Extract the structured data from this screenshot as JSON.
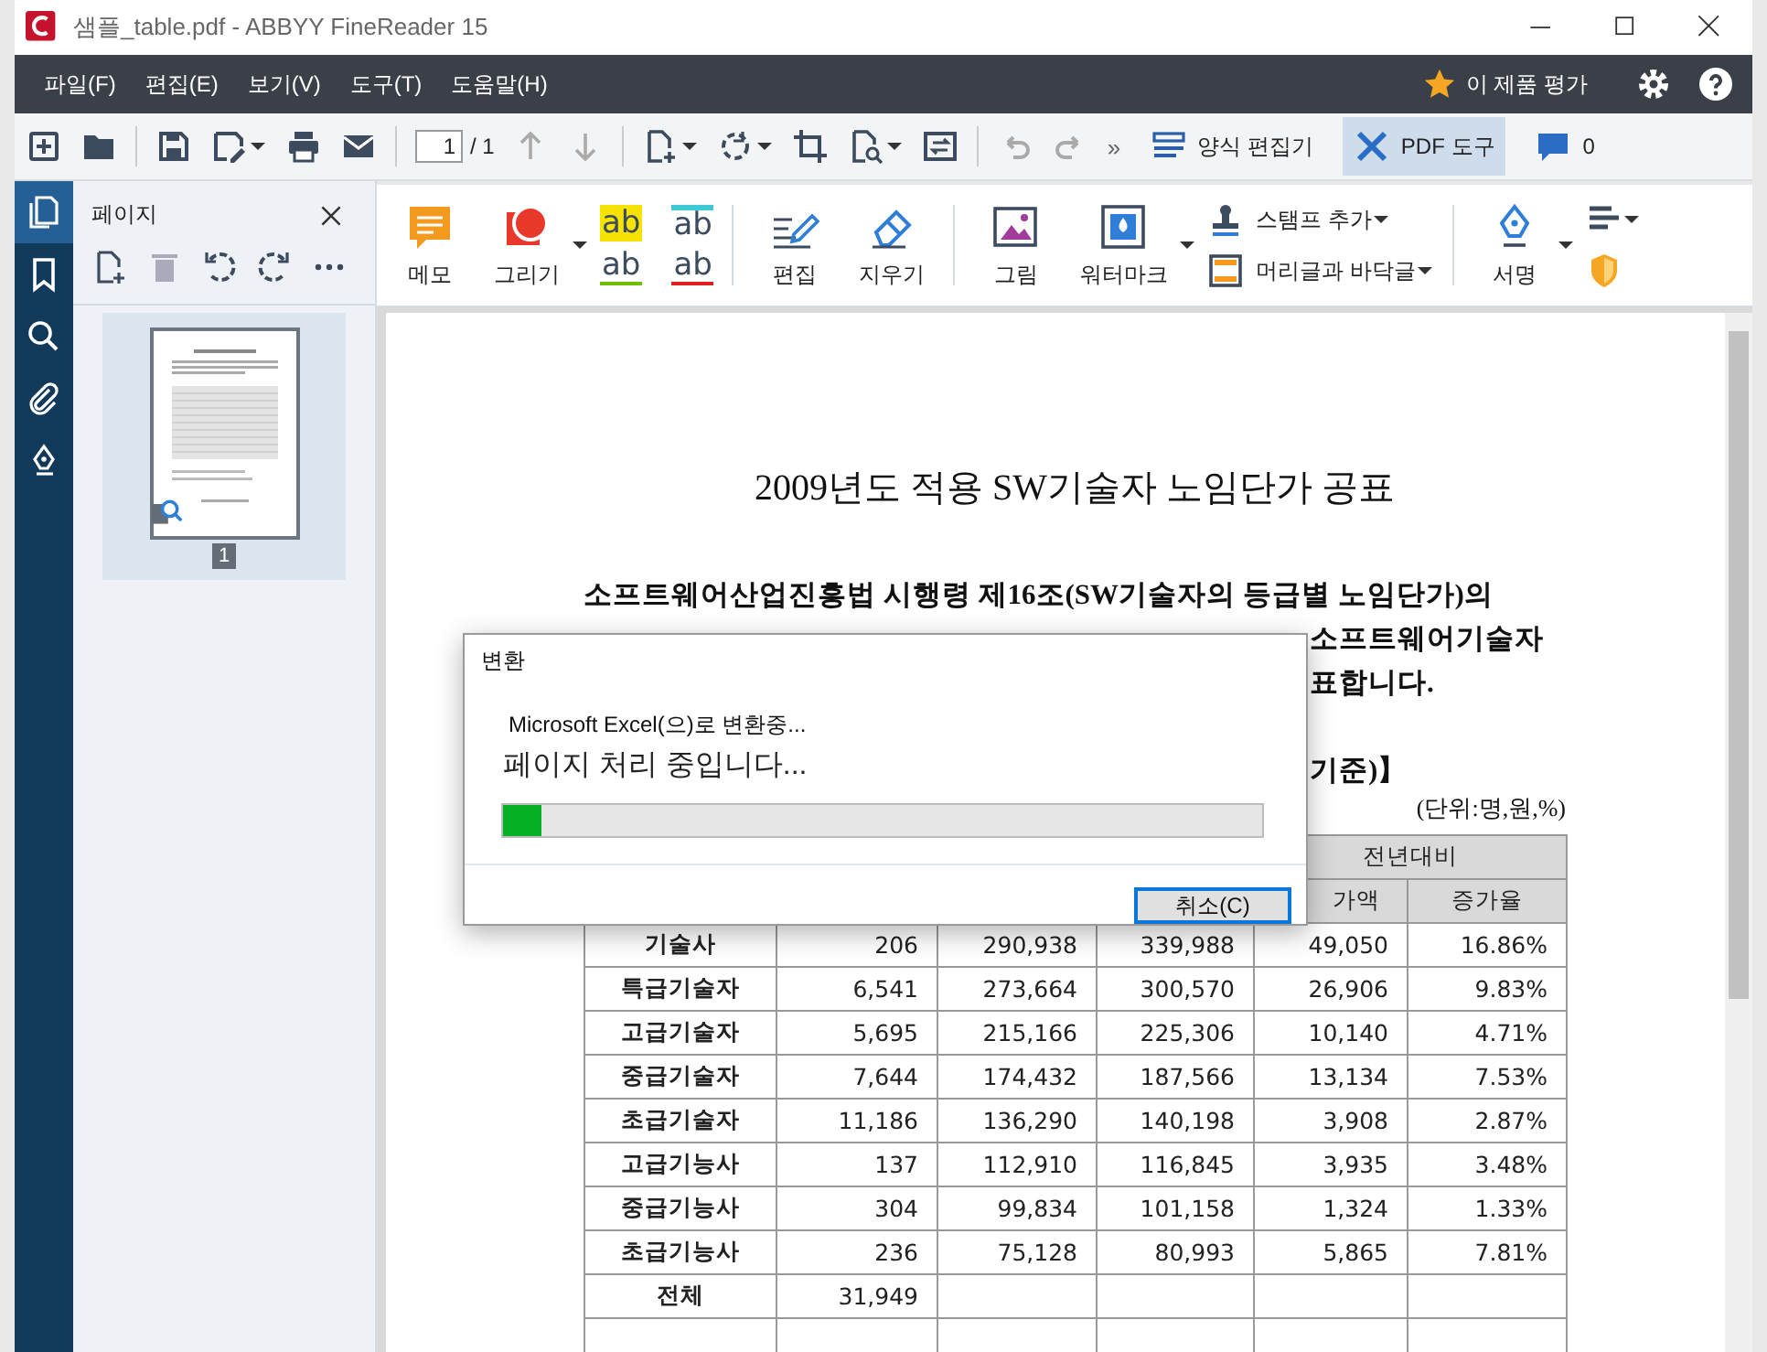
{
  "window": {
    "title": "샘플_table.pdf - ABBYY FineReader 15"
  },
  "menu": {
    "items": [
      "파일(F)",
      "편집(E)",
      "보기(V)",
      "도구(T)",
      "도움말(H)"
    ],
    "rate": "이 제품 평가"
  },
  "toolbar": {
    "page_field": "1",
    "page_total": "/ 1",
    "more": "»",
    "form_editor": "양식 편집기",
    "pdf_tools": {
      "label": "PDF 도구",
      "selected": true
    },
    "comments": "0"
  },
  "rail": [
    {
      "kind": "pages",
      "selected": true
    },
    {
      "kind": "bookmarks",
      "selected": false
    },
    {
      "kind": "search",
      "selected": false
    },
    {
      "kind": "attachments",
      "selected": false
    },
    {
      "kind": "signatures",
      "selected": false
    }
  ],
  "pages_panel": {
    "title": "페이지",
    "pages": [
      {
        "number": "1",
        "selected": true
      }
    ]
  },
  "pdf_toolbar": {
    "annotate": [
      {
        "kind": "memo",
        "label": "메모"
      },
      {
        "kind": "draw",
        "label": "그리기"
      }
    ],
    "text_marks": [
      {
        "kind": "highlight",
        "label": "ab"
      },
      {
        "kind": "insert",
        "label": "ab"
      },
      {
        "kind": "underline",
        "label": "ab"
      },
      {
        "kind": "strike",
        "label": "ab"
      }
    ],
    "edit_tools": [
      {
        "kind": "edit",
        "label": "편집"
      },
      {
        "kind": "erase",
        "label": "지우기"
      }
    ],
    "insert_tools": [
      {
        "kind": "image",
        "label": "그림"
      },
      {
        "kind": "watermark",
        "label": "워터마크"
      }
    ],
    "stamp": "스탬프 추가",
    "header_footer": "머리글과 바닥글",
    "sign": "서명"
  },
  "document": {
    "title": "2009년도 적용 SW기술자 노임단가 공표",
    "paragraph_line": "소프트웨어산업진흥법 시행령 제16조(SW기술자의 등급별 노임단가)의",
    "fragments": [
      "소프트웨어기술자",
      "표합니다.",
      "기준)】"
    ],
    "unit": "(단위:명,원,%)",
    "table": {
      "group_header": "전년대비",
      "columns": [
        "",
        "",
        "",
        "",
        "가액",
        "증가율"
      ],
      "rows": [
        [
          "기술사",
          "206",
          "290,938",
          "339,988",
          "49,050",
          "16.86%"
        ],
        [
          "특급기술자",
          "6,541",
          "273,664",
          "300,570",
          "26,906",
          "9.83%"
        ],
        [
          "고급기술자",
          "5,695",
          "215,166",
          "225,306",
          "10,140",
          "4.71%"
        ],
        [
          "중급기술자",
          "7,644",
          "174,432",
          "187,566",
          "13,134",
          "7.53%"
        ],
        [
          "초급기술자",
          "11,186",
          "136,290",
          "140,198",
          "3,908",
          "2.87%"
        ],
        [
          "고급기능사",
          "137",
          "112,910",
          "116,845",
          "3,935",
          "3.48%"
        ],
        [
          "중급기능사",
          "304",
          "99,834",
          "101,158",
          "1,324",
          "1.33%"
        ],
        [
          "초급기능사",
          "236",
          "75,128",
          "80,993",
          "5,865",
          "7.81%"
        ],
        [
          "전체",
          "31,949"
        ]
      ]
    }
  },
  "dialog": {
    "title": "변환",
    "message": "Microsoft Excel(으)로 변환중...",
    "status": "페이지 처리 중입니다...",
    "level": 0.05,
    "button": "취소(C)"
  }
}
